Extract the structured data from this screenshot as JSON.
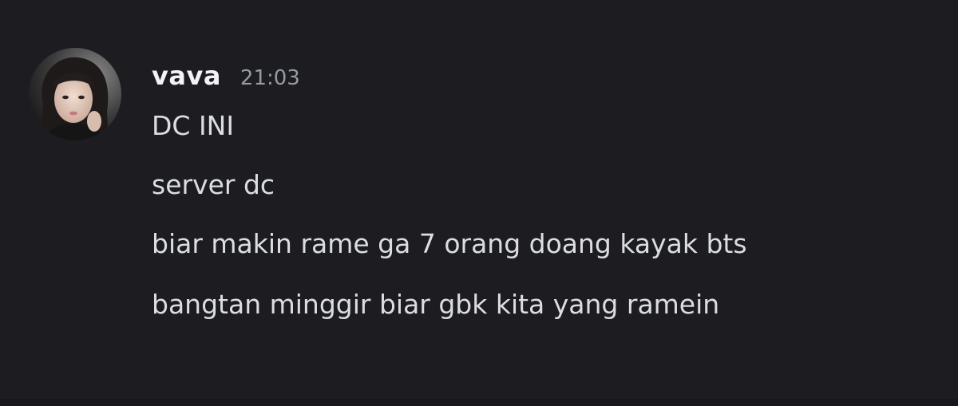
{
  "message": {
    "author": "vava",
    "timestamp": "21:03",
    "avatar_icon": "user-avatar-photo",
    "lines": [
      "DC INI",
      "server dc",
      "biar makin rame ga 7 orang doang kayak bts",
      "bangtan minggir biar gbk kita yang ramein"
    ]
  },
  "colors": {
    "background": "#1c1c21",
    "username": "#f2f3f5",
    "timestamp": "#949ba4",
    "text": "#dbdee1"
  }
}
